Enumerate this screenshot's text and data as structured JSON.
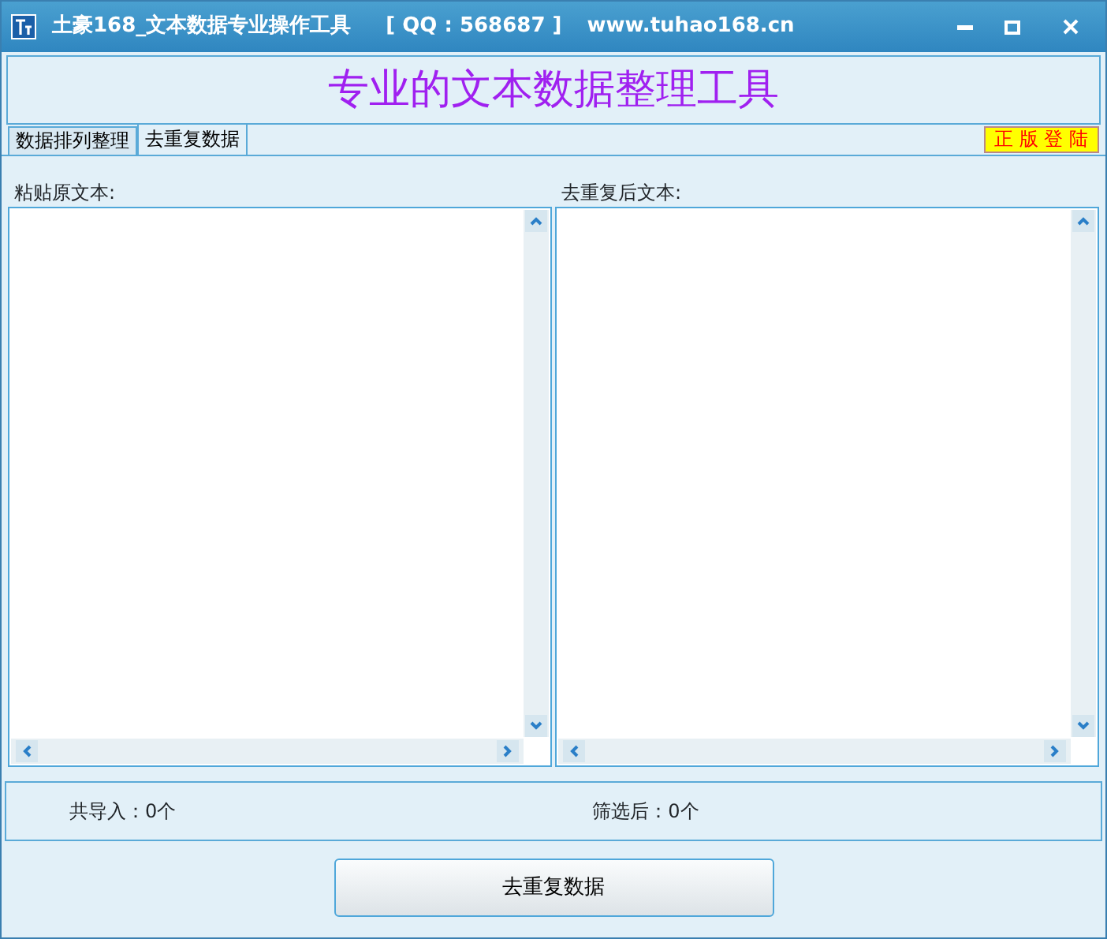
{
  "window": {
    "app_name": "土豪168_文本数据专业操作工具",
    "qq": "[ QQ : 568687 ]",
    "website": "www.tuhao168.cn"
  },
  "banner": {
    "title": "专业的文本数据整理工具"
  },
  "tabs": [
    {
      "label": "数据排列整理",
      "selected": false
    },
    {
      "label": "去重复数据",
      "selected": true
    }
  ],
  "login_button": "正 版 登 陆",
  "panes": [
    {
      "label": "粘贴原文本:"
    },
    {
      "label": "去重复后文本:"
    }
  ],
  "stats": [
    "共导入：0个",
    "筛选后：0个"
  ],
  "action_button": "去重复数据"
}
